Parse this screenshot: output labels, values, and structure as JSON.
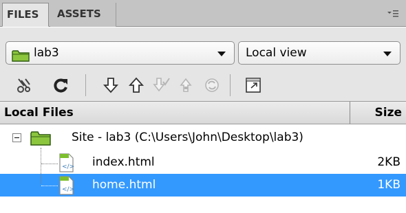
{
  "tabs": [
    {
      "label": "FILES",
      "active": true
    },
    {
      "label": "ASSETS",
      "active": false
    }
  ],
  "panel_menu_icon": "panel-options-icon",
  "site_select": {
    "value": "lab3",
    "icon": "folder-icon"
  },
  "view_select": {
    "value": "Local view"
  },
  "toolbar": [
    {
      "name": "connect-icon",
      "enabled": true
    },
    {
      "name": "refresh-icon",
      "enabled": true
    },
    {
      "name": "get-files-icon",
      "enabled": true
    },
    {
      "name": "put-files-icon",
      "enabled": true
    },
    {
      "name": "check-out-icon",
      "enabled": false
    },
    {
      "name": "check-in-icon",
      "enabled": false
    },
    {
      "name": "synchronize-icon",
      "enabled": false
    },
    {
      "name": "expand-panel-icon",
      "enabled": true
    }
  ],
  "columns": {
    "name": "Local Files",
    "size": "Size"
  },
  "tree": {
    "site_label": "Site - lab3 (C:\\Users\\John\\Desktop\\lab3)",
    "files": [
      {
        "name": "index.html",
        "size": "2KB",
        "selected": false
      },
      {
        "name": "home.html",
        "size": "1KB",
        "selected": true
      }
    ]
  },
  "colors": {
    "selection": "#3399ff",
    "folder": "#7dbf2e",
    "toolbar_bg": "#e5e5e5"
  }
}
